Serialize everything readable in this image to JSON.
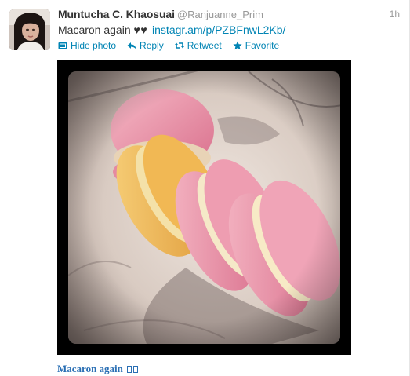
{
  "tweet": {
    "full_name": "Muntucha C. Khaosuai",
    "username": "@Ranjuanne_Prim",
    "time": "1h",
    "text": "Macaron again",
    "hearts": "♥♥",
    "link": "instagr.am/p/PZBFnwL2Kb/",
    "avatar_icon": "avatar-photo"
  },
  "actions": {
    "hide_photo": "Hide photo",
    "reply": "Reply",
    "retweet": "Retweet",
    "favorite": "Favorite"
  },
  "media": {
    "caption": "Macaron again",
    "caption_glyphs": "▯▯"
  },
  "colors": {
    "link": "#0084b4",
    "text": "#333333",
    "muted": "#999999",
    "caption": "#2a6fb4"
  }
}
